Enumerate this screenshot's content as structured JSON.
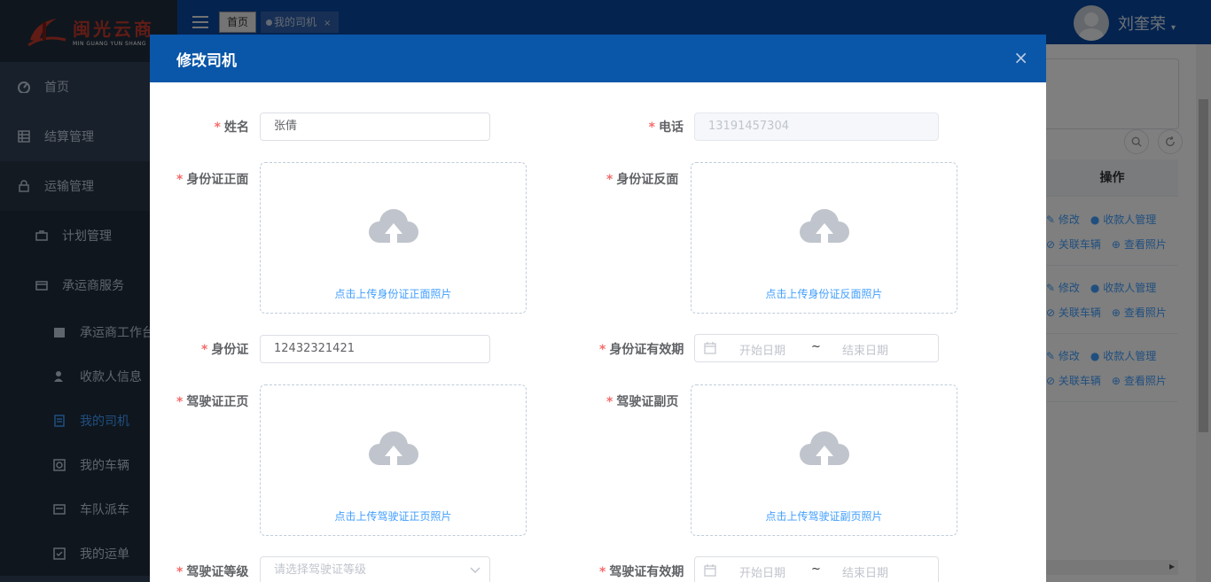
{
  "logo": {
    "cn": "闽光云商",
    "en": "MIN GUANG YUN SHANG"
  },
  "sidebar": {
    "items": [
      {
        "label": "首页",
        "icon": "dashboard-icon"
      },
      {
        "label": "结算管理",
        "icon": "table-icon"
      },
      {
        "label": "运输管理",
        "icon": "lock-icon"
      }
    ],
    "sub": [
      {
        "label": "计划管理",
        "icon": "briefcase-icon"
      },
      {
        "label": "承运商服务",
        "icon": "card-icon"
      }
    ],
    "leaves": [
      {
        "label": "承运商工作台",
        "icon": "calendar-icon"
      },
      {
        "label": "收款人信息",
        "icon": "user-icon"
      },
      {
        "label": "我的司机",
        "icon": "document-icon"
      },
      {
        "label": "我的车辆",
        "icon": "vehicle-icon"
      },
      {
        "label": "车队派车",
        "icon": "dispatch-icon"
      },
      {
        "label": "我的运单",
        "icon": "checkbox-icon"
      }
    ]
  },
  "navbar": {
    "tabs": [
      {
        "label": "首页"
      },
      {
        "label": "我的司机",
        "close": "×"
      }
    ],
    "username": "刘奎荣",
    "caret": "▾"
  },
  "background_table": {
    "header": "操作",
    "row_actions": {
      "edit": "修改",
      "payee": "收款人管理",
      "link_vehicle": "关联车辆",
      "view_photo": "查看照片"
    }
  },
  "dialog": {
    "title": "修改司机",
    "close": "×",
    "fields": {
      "name": {
        "label": "姓名",
        "value": "张倩"
      },
      "phone": {
        "label": "电话",
        "value": "13191457304"
      },
      "id_front": {
        "label": "身份证正面",
        "hint": "点击上传身份证正面照片"
      },
      "id_back": {
        "label": "身份证反面",
        "hint": "点击上传身份证反面照片"
      },
      "id_number": {
        "label": "身份证",
        "value": "12432321421"
      },
      "id_validity": {
        "label": "身份证有效期",
        "start_placeholder": "开始日期",
        "separator": "~",
        "end_placeholder": "结束日期"
      },
      "license_front": {
        "label": "驾驶证正页",
        "hint": "点击上传驾驶证正页照片"
      },
      "license_back": {
        "label": "驾驶证副页",
        "hint": "点击上传驾驶证副页照片"
      },
      "license_class": {
        "label": "驾驶证等级",
        "placeholder": "请选择驾驶证等级"
      },
      "license_validity": {
        "label": "驾驶证有效期",
        "start_placeholder": "开始日期",
        "separator": "~",
        "end_placeholder": "结束日期"
      }
    },
    "required_mark": "*"
  },
  "colors": {
    "header_blue": "#0a56a8",
    "navbar_blue": "#08479e",
    "sidebar_bg": "#304156",
    "link_blue": "#409eff",
    "required_red": "#f56c6c"
  }
}
